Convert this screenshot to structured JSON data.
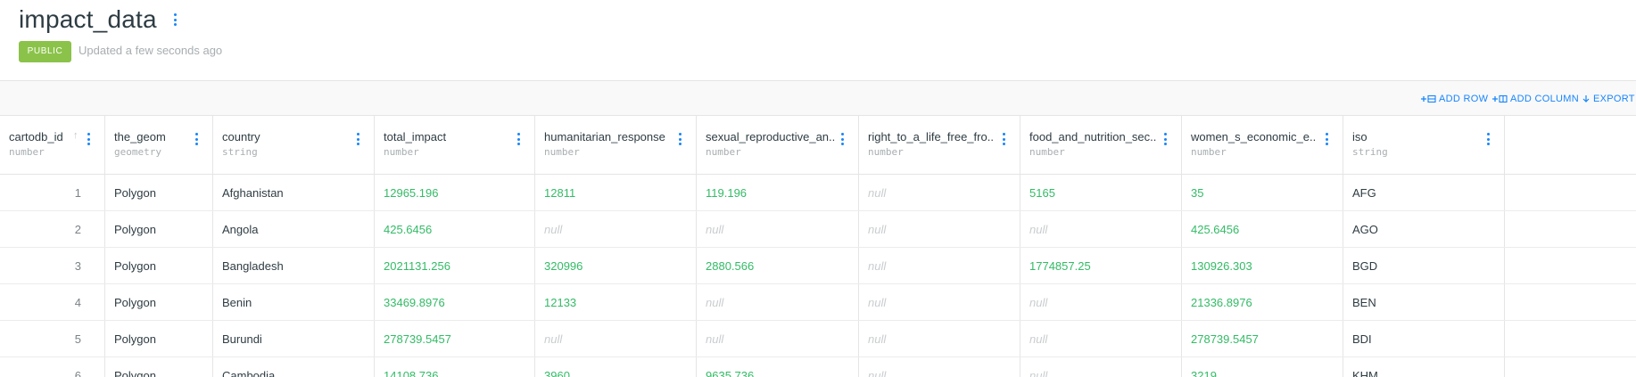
{
  "dataset": {
    "title": "impact_data",
    "badge": "PUBLIC",
    "updated": "Updated a few seconds ago",
    "accent_color": "#1785fb",
    "badge_color": "#8bc34a"
  },
  "toolbar": {
    "add_row": "ADD ROW",
    "add_column": "ADD COLUMN",
    "export": "EXPORT"
  },
  "columns": [
    {
      "name": "cartodb_id",
      "type": "number"
    },
    {
      "name": "the_geom",
      "type": "geometry"
    },
    {
      "name": "country",
      "type": "string"
    },
    {
      "name": "total_impact",
      "type": "number"
    },
    {
      "name": "humanitarian_response",
      "type": "number"
    },
    {
      "name": "sexual_reproductive_an..",
      "type": "number"
    },
    {
      "name": "right_to_a_life_free_fro..",
      "type": "number"
    },
    {
      "name": "food_and_nutrition_sec..",
      "type": "number"
    },
    {
      "name": "women_s_economic_e..",
      "type": "number"
    },
    {
      "name": "iso",
      "type": "string"
    }
  ],
  "rows": [
    [
      "1",
      "Polygon",
      "Afghanistan",
      "12965.196",
      "12811",
      "119.196",
      "null",
      "5165",
      "35",
      "AFG"
    ],
    [
      "2",
      "Polygon",
      "Angola",
      "425.6456",
      "null",
      "null",
      "null",
      "null",
      "425.6456",
      "AGO"
    ],
    [
      "3",
      "Polygon",
      "Bangladesh",
      "2021131.256",
      "320996",
      "2880.566",
      "null",
      "1774857.25",
      "130926.303",
      "BGD"
    ],
    [
      "4",
      "Polygon",
      "Benin",
      "33469.8976",
      "12133",
      "null",
      "null",
      "null",
      "21336.8976",
      "BEN"
    ],
    [
      "5",
      "Polygon",
      "Burundi",
      "278739.5457",
      "null",
      "null",
      "null",
      "null",
      "278739.5457",
      "BDI"
    ],
    [
      "6",
      "Polygon",
      "Cambodia",
      "14108.736",
      "3960",
      "9635.736",
      "null",
      "null",
      "3219",
      "KHM"
    ]
  ]
}
